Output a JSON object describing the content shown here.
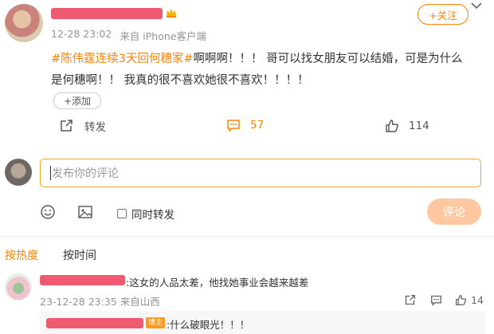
{
  "post": {
    "username": "",
    "time": "12-28 23:02",
    "source": "来自 iPhone客户端",
    "follow_label": "+关注",
    "hashtag": "#陈伟霆连续3天回何穗家#",
    "text_line1": "啊啊啊！！！ 哥可以找女朋友可以结婚，可是为什么",
    "text_line2": "是何穗啊！！ 我真的很不喜欢她很不喜欢！！！！",
    "add_label": "+添加",
    "repost_label": "转发",
    "comment_count": "57",
    "like_count": "114"
  },
  "composer": {
    "placeholder": "发布你的评论",
    "repost_label": "同时转发",
    "submit_label": "评论"
  },
  "sort": {
    "hot_label": "按热度",
    "time_label": "按时间"
  },
  "comment": {
    "text": ":这女的人品太差，他找她事业会越来越差",
    "meta": "23-12-28 23:35 来自山西",
    "like_count": "14"
  },
  "reply": {
    "badge": "博主",
    "text": ":什么破眼光！！！"
  },
  "colors": {
    "accent": "#ff8200",
    "redaction": "#f05a70",
    "submit_bg": "#ffc8a0"
  }
}
